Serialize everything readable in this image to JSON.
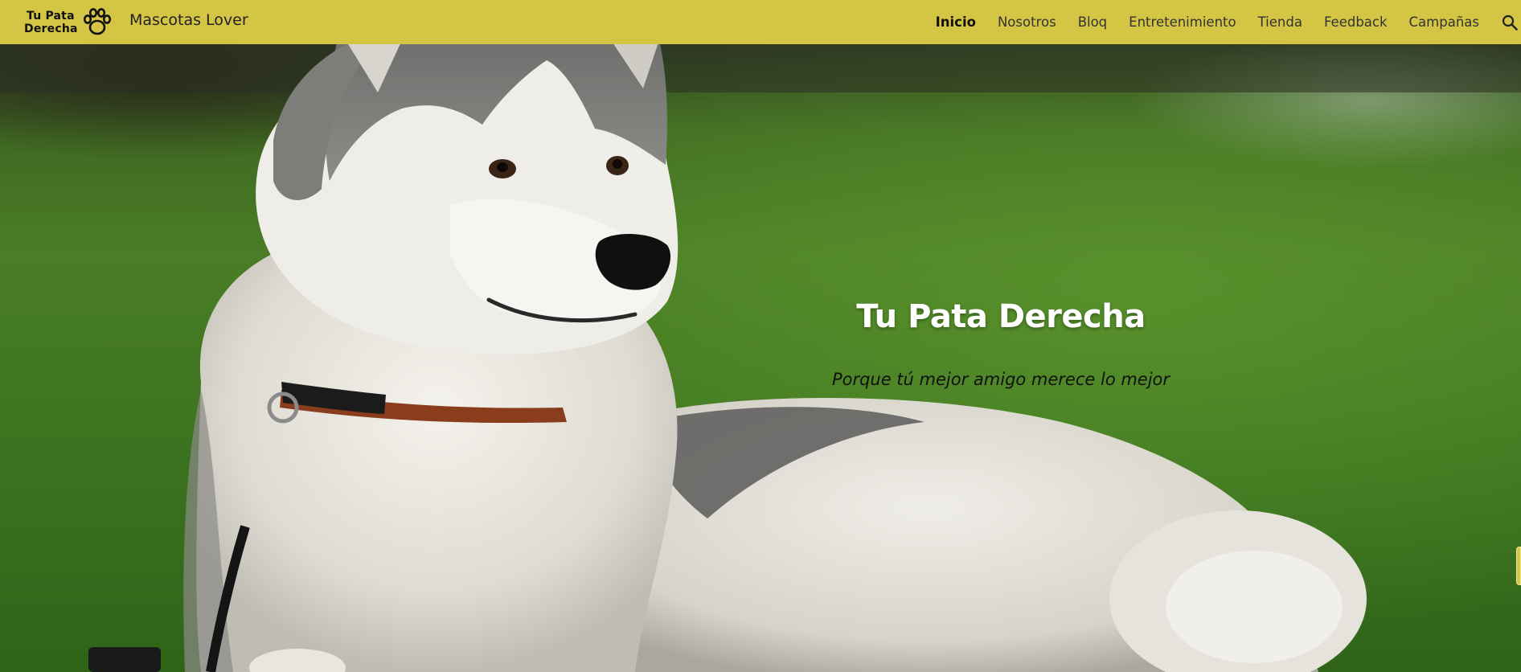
{
  "header": {
    "logo_line1": "Tu Pata",
    "logo_line2": "Derecha",
    "site_name": "Mascotas Lover",
    "nav": [
      "Inicio",
      "Nosotros",
      "Bloq",
      "Entretenimiento",
      "Tienda",
      "Feedback",
      "Campañas"
    ],
    "active": "Inicio",
    "search_icon": "search-icon"
  },
  "hero": {
    "title": "Tu Pata Derecha",
    "subtitle": "Porque tú mejor amigo merece lo mejor"
  },
  "colors": {
    "header_bg": "#d4c545",
    "title": "#ffffff",
    "subtitle": "#111111"
  }
}
